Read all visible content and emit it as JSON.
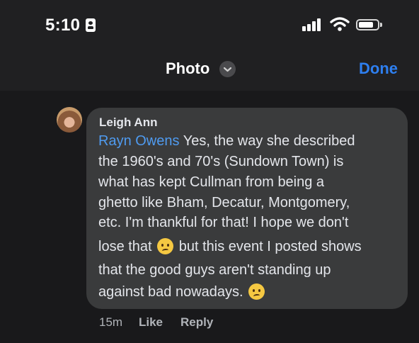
{
  "status_bar": {
    "time": "5:10",
    "icons": [
      "id-card-icon",
      "cellular-signal-icon",
      "wifi-icon",
      "battery-icon"
    ],
    "battery_level": 0.78
  },
  "nav": {
    "title": "Photo",
    "chevron_icon": "chevron-down-icon",
    "done_label": "Done"
  },
  "comment": {
    "author": "Leigh Ann",
    "mention": "Rayn Owens",
    "lines": [
      " Yes, the way she described",
      "the 1960's and 70's (Sundown Town) is",
      "what has kept Cullman from being a",
      "ghetto like Bham, Decatur, Montgomery,",
      "etc. I'm thankful for that! I hope we don't",
      "lose that",
      "but this event I posted shows",
      "that the good guys aren't standing up",
      "against bad nowadays."
    ],
    "emoji": "confused-face-emoji",
    "timestamp": "15m",
    "like_label": "Like",
    "reply_label": "Reply"
  },
  "colors": {
    "background": "#19191b",
    "header": "#202022",
    "bubble": "#3a3b3c",
    "accent": "#2e7ff0",
    "mention": "#4f9bf0"
  }
}
